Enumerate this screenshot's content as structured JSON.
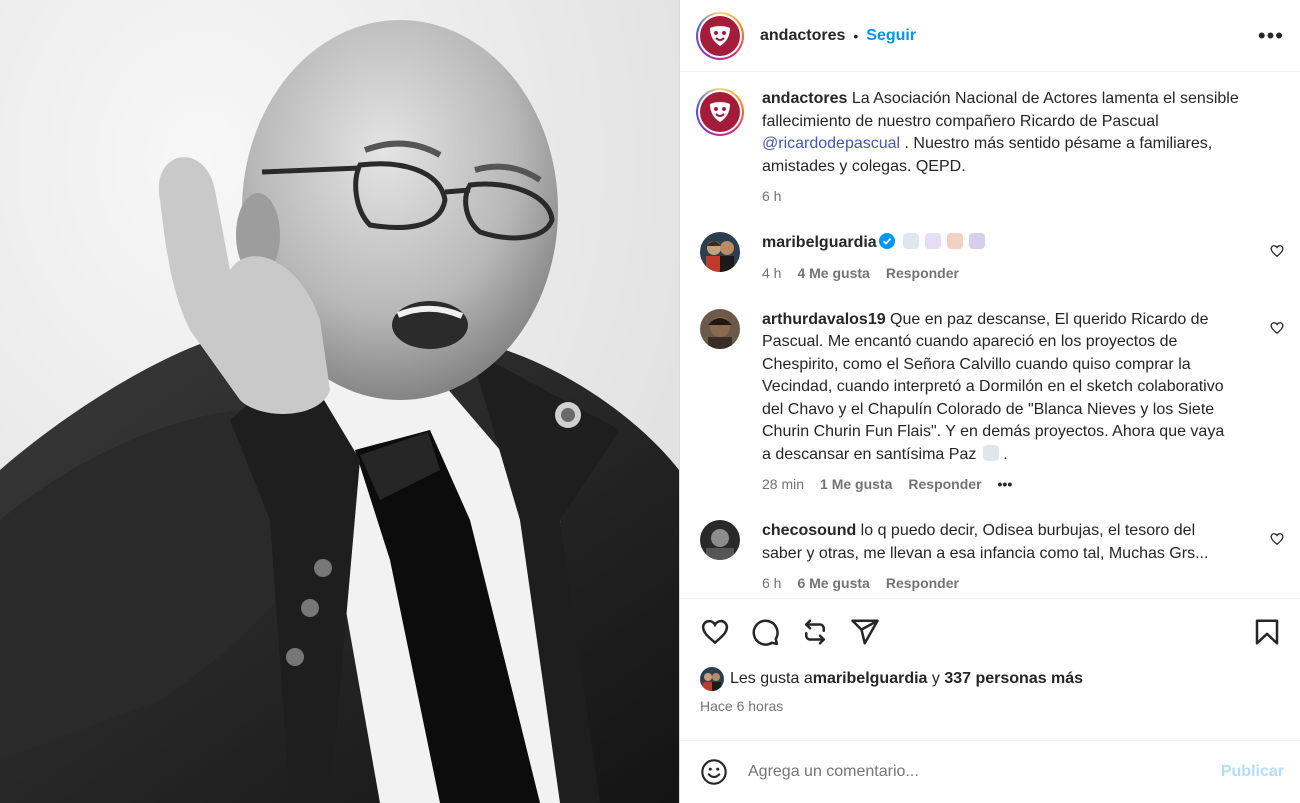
{
  "post": {
    "username": "andactores",
    "follow_label": "Seguir",
    "more_label": "•••"
  },
  "caption": {
    "username": "andactores",
    "text_before": " La Asociación Nacional de Actores lamenta el sensible fallecimiento de nuestro compañero Ricardo de Pascual ",
    "mention": "@ricardodepascual",
    "text_after": " . Nuestro más sentido pésame a familiares, amistades y colegas. QEPD.",
    "time": "6 h"
  },
  "comments": [
    {
      "username": "maribelguardia",
      "verified": true,
      "text": "",
      "time": "4 h",
      "likes": "4 Me gusta",
      "reply": "Responder"
    },
    {
      "username": "arthurdavalos19",
      "text": " Que en paz descanse, El querido Ricardo de Pascual. Me encantó cuando apareció en los proyectos de Chespirito, como el Señora Calvillo cuando quiso comprar la Vecindad, cuando interpretó a Dormilón en el sketch colaborativo del Chavo y el Chapulín Colorado de \"Blanca Nieves y los Siete Churin Churin Fun Flais\". Y en demás proyectos. Ahora que vaya a descansar en santísima Paz",
      "text_end": " .",
      "time": "28 min",
      "likes": "1 Me gusta",
      "reply": "Responder",
      "more": "•••"
    },
    {
      "username": "checosound",
      "text": " lo q puedo decir, Odisea burbujas, el tesoro del saber y otras, me llevan a esa infancia como tal, Muchas Grs...",
      "time": "6 h",
      "likes": "6 Me gusta",
      "reply": "Responder"
    }
  ],
  "likes": {
    "prefix": "Les gusta a ",
    "user": "maribelguardia",
    "middle": " y ",
    "others": "337 personas más"
  },
  "posted": "Hace 6 horas",
  "add_comment": {
    "placeholder": "Agrega un comentario...",
    "post_label": "Publicar"
  },
  "colors": {
    "follow": "#0095f6",
    "mention": "#4458b8",
    "brand": "#a51c3a",
    "publish_disabled": "#b2dffc"
  }
}
